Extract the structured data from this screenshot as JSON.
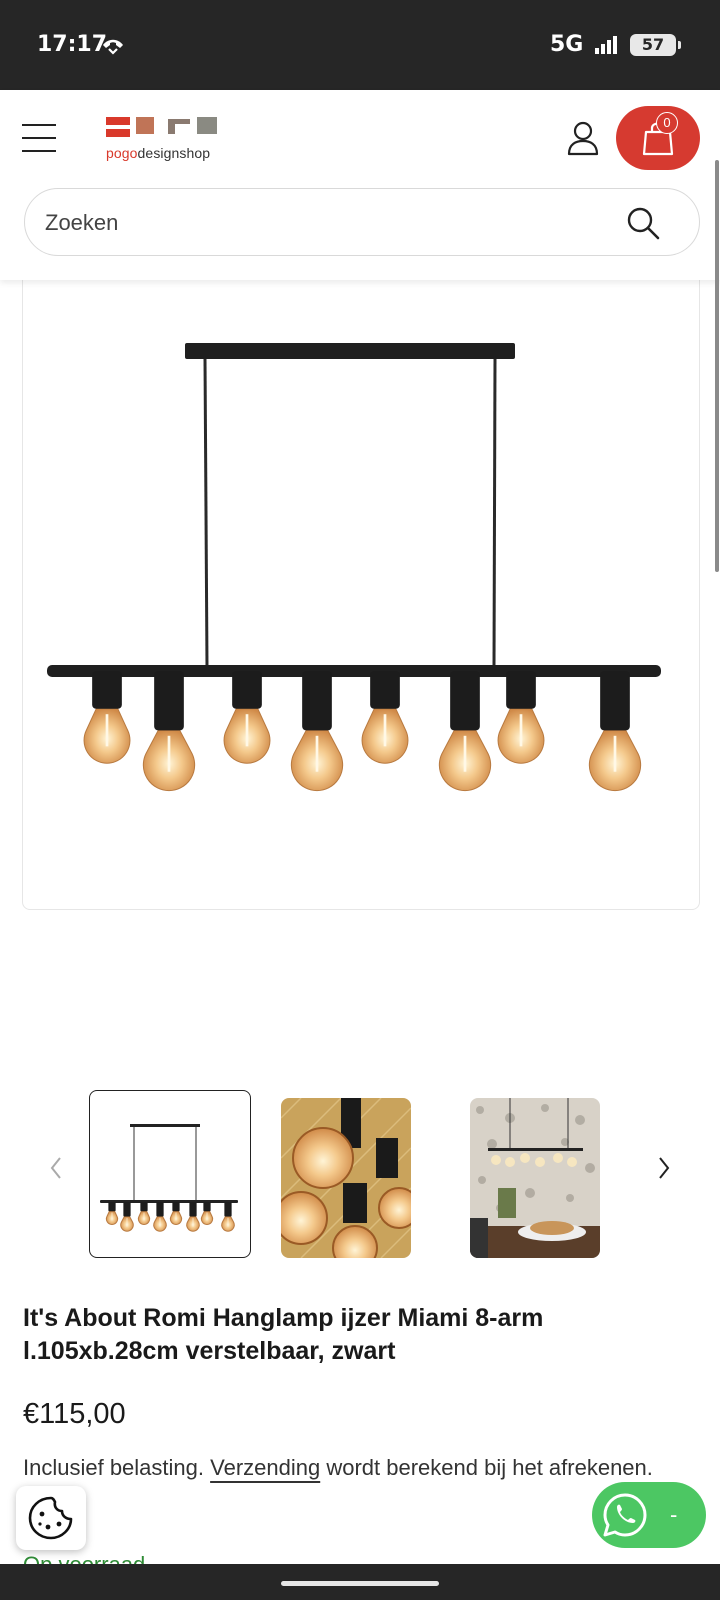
{
  "status_bar": {
    "time": "17:17",
    "network": "5G",
    "battery": "57"
  },
  "header": {
    "logo_text_pre": "pogo",
    "logo_text_post": "designshop",
    "cart_count": "0",
    "colors": {
      "brand_red": "#d63a30",
      "whatsapp_green": "#4cc763"
    },
    "icons": [
      "menu-icon",
      "account-icon",
      "cart-icon",
      "search-icon"
    ]
  },
  "search": {
    "placeholder": "Zoeken"
  },
  "product": {
    "title": "It's About Romi Hanglamp ijzer Miami 8-arm l.105xb.28cm verstelbaar, zwart",
    "price": "€115,00",
    "tax_prefix": "Inclusief belasting.",
    "shipping_link": "Verzending",
    "tax_suffix": "wordt berekend bij het afrekenen.",
    "stock_status": "Op voorraad"
  },
  "thumbnails": {
    "count": 3,
    "selected_index": 0
  },
  "whatsapp": {
    "label": "-"
  }
}
